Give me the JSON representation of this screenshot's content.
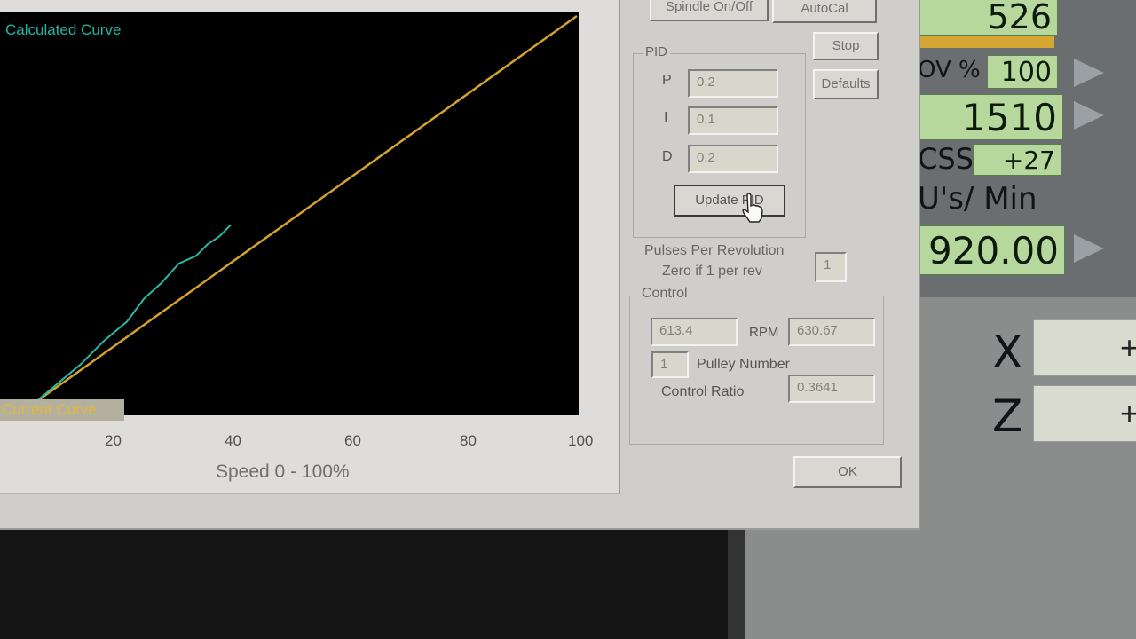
{
  "graph": {
    "calculated_label": "Calculated Curve",
    "current_label": "Current Curve",
    "x_ticks": [
      "20",
      "40",
      "60",
      "80",
      "100"
    ],
    "x_axis_label": "Speed 0 - 100%",
    "colors": {
      "calculated": "#d4a22c",
      "current": "#2bb7a4",
      "background": "#000000"
    }
  },
  "chart_data": {
    "type": "line",
    "xlabel": "Speed 0 - 100%",
    "xlim": [
      0,
      100
    ],
    "ylim": [
      0,
      100
    ],
    "series": [
      {
        "name": "Calculated Curve",
        "x": [
          6,
          100
        ],
        "y": [
          0,
          100
        ]
      },
      {
        "name": "Current Curve",
        "x": [
          6,
          10,
          14,
          18,
          22,
          25,
          28,
          31,
          34,
          36,
          38,
          40
        ],
        "y": [
          0,
          5,
          10,
          16,
          21,
          27,
          31,
          36,
          38,
          41,
          43,
          46
        ]
      }
    ]
  },
  "top_buttons": {
    "spindle": "Spindle On/Off",
    "autocal": "AutoCal",
    "stop": "Stop",
    "defaults": "Defaults"
  },
  "pid": {
    "title": "PID",
    "p_label": "P",
    "p_value": "0.2",
    "i_label": "I",
    "i_value": "0.1",
    "d_label": "D",
    "d_value": "0.2",
    "update_button": "Update PID"
  },
  "pulses": {
    "line1": "Pulses Per Revolution",
    "line2": "Zero if 1 per rev",
    "value": "1"
  },
  "control": {
    "title": "Control",
    "speed_value": "613.4",
    "rpm_label": "RPM",
    "rpm_value": "630.67",
    "pulley_value": "1",
    "pulley_label": "Pulley Number",
    "ratio_label": "Control Ratio",
    "ratio_value": "0.3641"
  },
  "ok_button": "OK",
  "mach": {
    "dro_top": "526",
    "ov_label": "OV %",
    "ov_value": "100",
    "dro_1510": "1510",
    "css_label": "CSS",
    "css_value": "+27",
    "units_label": "U's/ Min",
    "feed_value": "920.00",
    "axis_x": "X",
    "axis_z": "Z",
    "x_value": "+",
    "z_value": "+"
  }
}
